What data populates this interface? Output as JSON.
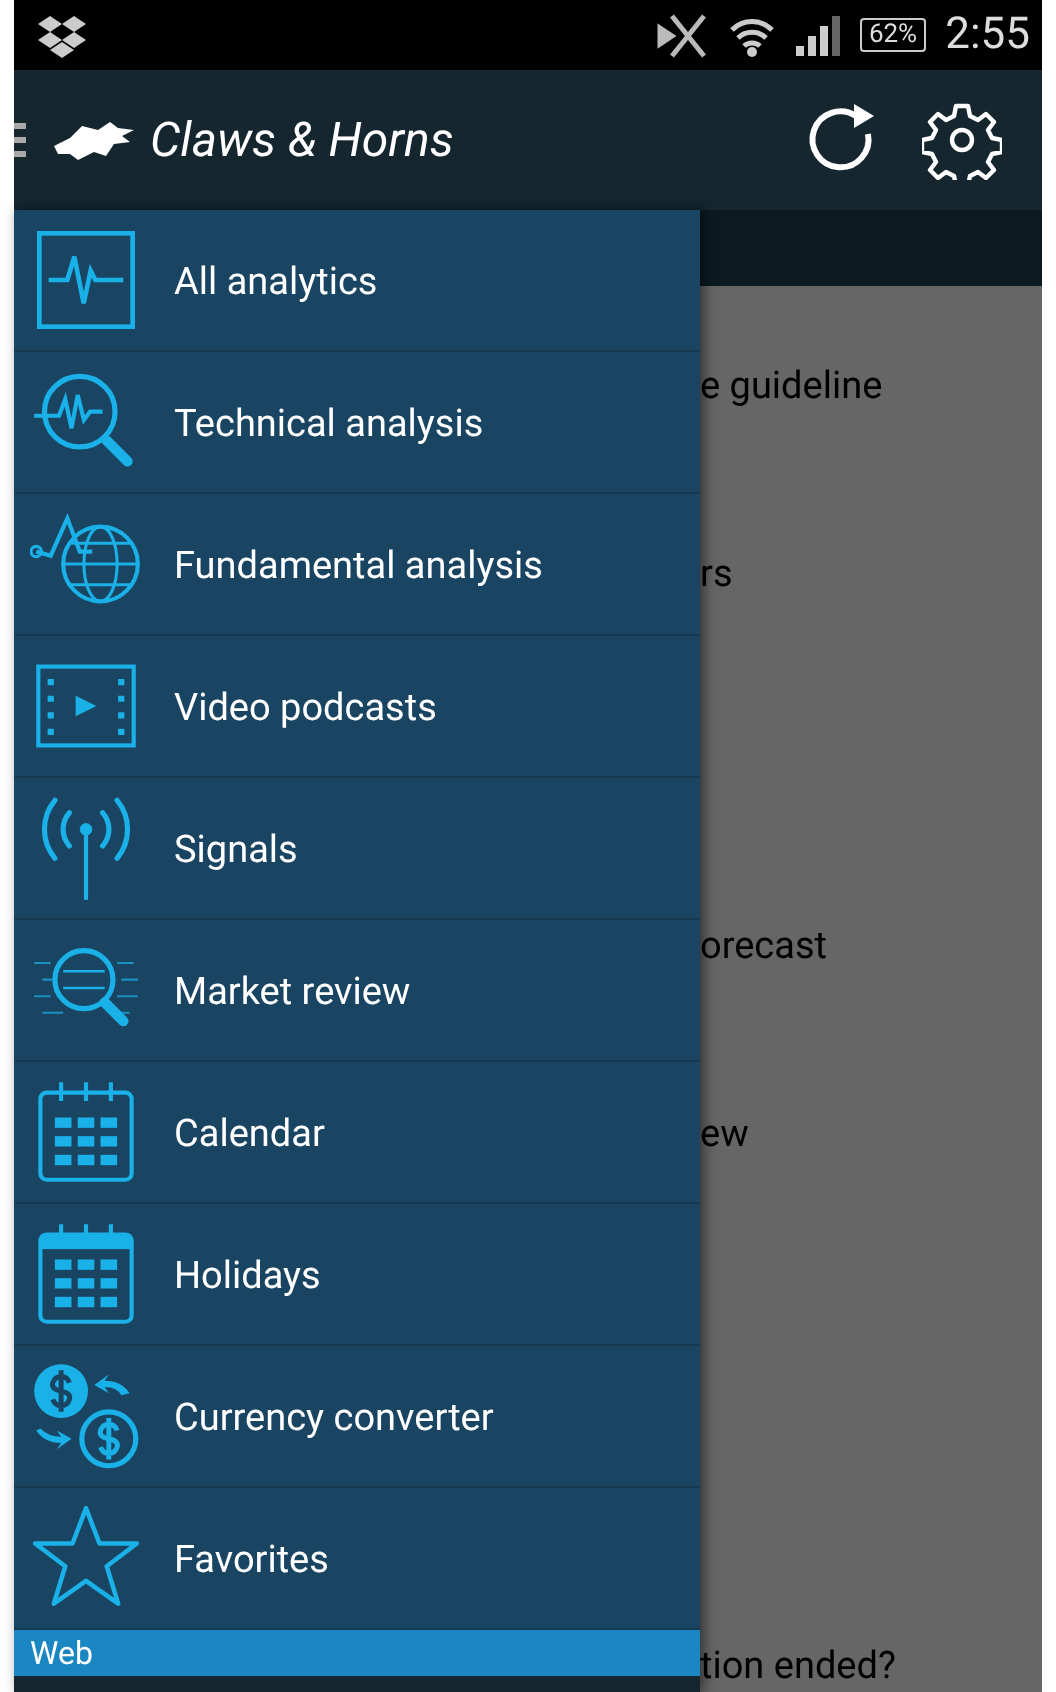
{
  "status_bar": {
    "battery": "62%",
    "time": "2:55"
  },
  "app_bar": {
    "title": "Claws & Horns"
  },
  "content": {
    "lines": [
      "e guideline",
      "rs",
      "orecast",
      "ew",
      "tion ended?"
    ]
  },
  "drawer": {
    "items": [
      {
        "label": "All analytics",
        "kind": "pulse"
      },
      {
        "label": "Technical analysis",
        "kind": "scope"
      },
      {
        "label": "Fundamental analysis",
        "kind": "globe"
      },
      {
        "label": "Video podcasts",
        "kind": "film"
      },
      {
        "label": "Signals",
        "kind": "antenna"
      },
      {
        "label": "Market review",
        "kind": "review"
      },
      {
        "label": "Calendar",
        "kind": "calendar"
      },
      {
        "label": "Holidays",
        "kind": "holidays"
      },
      {
        "label": "Currency converter",
        "kind": "currency"
      },
      {
        "label": "Favorites",
        "kind": "star"
      }
    ],
    "section": "Web"
  }
}
